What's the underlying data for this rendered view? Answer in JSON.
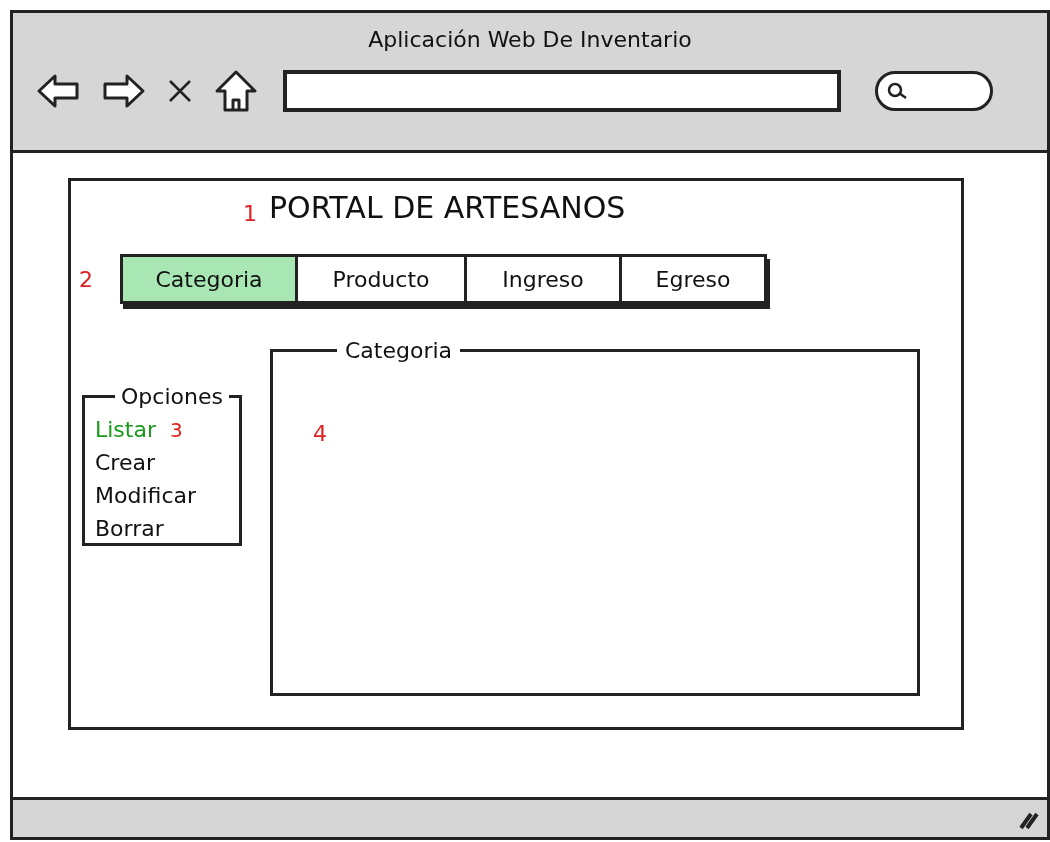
{
  "window": {
    "title": "Aplicación Web De Inventario"
  },
  "page": {
    "heading": "PORTAL DE ARTESANOS",
    "heading_marker": "1"
  },
  "tabs_marker": "2",
  "tabs": [
    {
      "label": "Categoria",
      "selected": true
    },
    {
      "label": "Producto",
      "selected": false
    },
    {
      "label": "Ingreso",
      "selected": false
    },
    {
      "label": "Egreso",
      "selected": false
    }
  ],
  "options": {
    "legend": "Opciones",
    "items": [
      {
        "label": "Listar",
        "selected": true,
        "marker": "3"
      },
      {
        "label": "Crear",
        "selected": false
      },
      {
        "label": "Modificar",
        "selected": false
      },
      {
        "label": "Borrar",
        "selected": false
      }
    ]
  },
  "content_group": {
    "legend": "Categoria",
    "marker": "4"
  }
}
